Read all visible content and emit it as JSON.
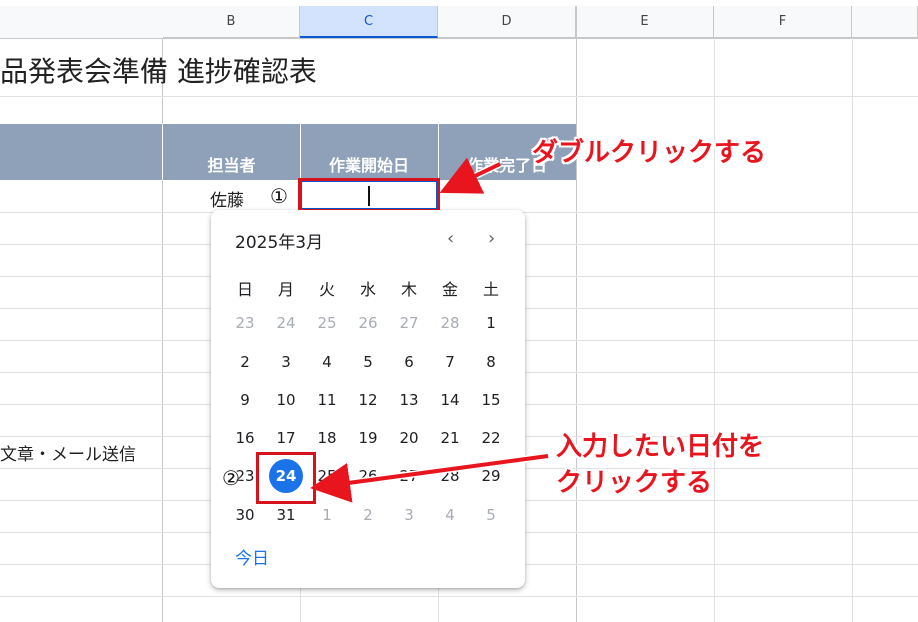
{
  "sheet": {
    "columns": [
      "B",
      "C",
      "D",
      "E",
      "F"
    ],
    "title": "品発表会準備 進捗確認表",
    "headers": {
      "assignee": "担当者",
      "start_date": "作業開始日",
      "end_date": "作業完了日"
    },
    "row_values": {
      "assignee_row1": "佐藤",
      "task_text": "文章・メール送信"
    }
  },
  "date_picker": {
    "month_label": "2025年3月",
    "prev_icon": "‹",
    "next_icon": "›",
    "weekdays": [
      "日",
      "月",
      "火",
      "水",
      "木",
      "金",
      "土"
    ],
    "weeks": [
      [
        "23",
        "24",
        "25",
        "26",
        "27",
        "28",
        "1"
      ],
      [
        "2",
        "3",
        "4",
        "5",
        "6",
        "7",
        "8"
      ],
      [
        "9",
        "10",
        "11",
        "12",
        "13",
        "14",
        "15"
      ],
      [
        "16",
        "17",
        "18",
        "19",
        "20",
        "21",
        "22"
      ],
      [
        "23",
        "24",
        "25",
        "26",
        "27",
        "28",
        "29"
      ],
      [
        "30",
        "31",
        "1",
        "2",
        "3",
        "4",
        "5"
      ]
    ],
    "muted_first_row": 6,
    "selected_day": "24",
    "today_label": "今日"
  },
  "annotations": {
    "step1_marker": "①",
    "step1_text": "ダブルクリックする",
    "step2_marker": "②",
    "step2_text_line1": "入力したい日付を",
    "step2_text_line2": "クリックする"
  },
  "colors": {
    "accent": "#1a73e8",
    "annotation_red": "#e8141e",
    "header_band": "#8ea1b8"
  }
}
